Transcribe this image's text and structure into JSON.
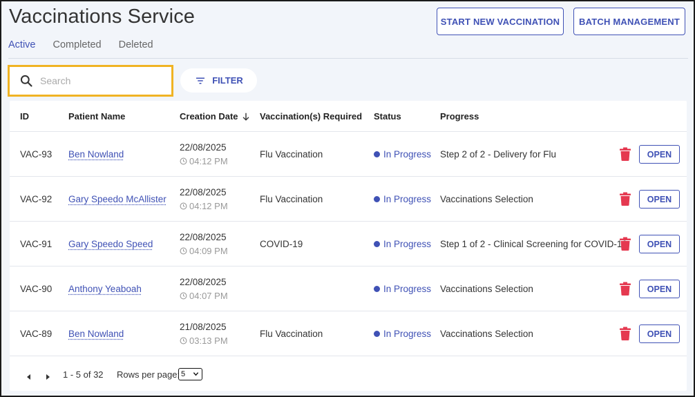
{
  "header": {
    "title": "Vaccinations Service",
    "start_new_label": "START NEW VACCINATION",
    "batch_label": "BATCH MANAGEMENT"
  },
  "tabs": [
    {
      "label": "Active",
      "active": true
    },
    {
      "label": "Completed",
      "active": false
    },
    {
      "label": "Deleted",
      "active": false
    }
  ],
  "search": {
    "placeholder": "Search",
    "value": "",
    "icon": "search-icon"
  },
  "filter": {
    "label": "FILTER",
    "icon": "filter-icon"
  },
  "table": {
    "columns": {
      "id": "ID",
      "patient": "Patient Name",
      "date": "Creation Date",
      "vacc": "Vaccination(s) Required",
      "status": "Status",
      "progress": "Progress"
    },
    "sort_icon": "arrow-down-icon",
    "rows": [
      {
        "id": "VAC-93",
        "patient": "Ben Nowland",
        "date": "22/08/2025",
        "time": "04:12 PM",
        "vacc": "Flu Vaccination",
        "status": "In Progress",
        "progress": "Step 2 of 2 - Delivery for Flu",
        "open": "OPEN"
      },
      {
        "id": "VAC-92",
        "patient": "Gary Speedo McAllister",
        "date": "22/08/2025",
        "time": "04:12 PM",
        "vacc": "Flu Vaccination",
        "status": "In Progress",
        "progress": "Vaccinations Selection",
        "open": "OPEN"
      },
      {
        "id": "VAC-91",
        "patient": "Gary Speedo Speed",
        "date": "22/08/2025",
        "time": "04:09 PM",
        "vacc": "COVID-19",
        "status": "In Progress",
        "progress": "Step 1 of 2 - Clinical Screening for COVID-19",
        "open": "OPEN"
      },
      {
        "id": "VAC-90",
        "patient": "Anthony Yeaboah",
        "date": "22/08/2025",
        "time": "04:07 PM",
        "vacc": "",
        "status": "In Progress",
        "progress": "Vaccinations Selection",
        "open": "OPEN"
      },
      {
        "id": "VAC-89",
        "patient": "Ben Nowland",
        "date": "21/08/2025",
        "time": "03:13 PM",
        "vacc": "Flu Vaccination",
        "status": "In Progress",
        "progress": "Vaccinations Selection",
        "open": "OPEN"
      }
    ]
  },
  "pagination": {
    "range": "1 - 5 of 32",
    "rows_label": "Rows per page:",
    "rows_value": "5"
  },
  "colors": {
    "accent": "#3f51b5",
    "delete": "#e53950",
    "search_highlight": "#f0b323",
    "background": "#f2f5fa"
  }
}
